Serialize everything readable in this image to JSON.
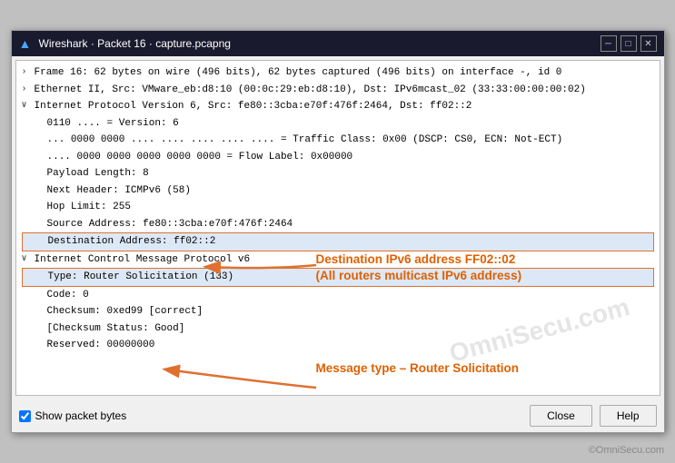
{
  "window": {
    "title": "Wireshark · Packet 16 · capture.pcapng",
    "titlebar_icon": "▲"
  },
  "titlebar_buttons": {
    "minimize": "─",
    "maximize": "□",
    "close": "✕"
  },
  "packet_rows": [
    {
      "id": "frame",
      "toggle": "›",
      "indent": 0,
      "text": "Frame 16: 62 bytes on wire (496 bits), 62 bytes captured (496 bits) on interface -, id 0",
      "highlight": false
    },
    {
      "id": "ethernet",
      "toggle": "›",
      "indent": 0,
      "text": "Ethernet II, Src: VMware_eb:d8:10 (00:0c:29:eb:d8:10), Dst: IPv6mcast_02 (33:33:00:00:00:02)",
      "highlight": false
    },
    {
      "id": "ipv6",
      "toggle": "∨",
      "indent": 0,
      "text": "Internet Protocol Version 6, Src: fe80::3cba:e70f:476f:2464, Dst: ff02::2",
      "highlight": false
    },
    {
      "id": "version",
      "toggle": " ",
      "indent": 1,
      "text": "0110 .... = Version: 6",
      "highlight": false
    },
    {
      "id": "traffic_class1",
      "toggle": " ",
      "indent": 1,
      "text": "... 0000 0000 .... .... .... .... .... = Traffic Class: 0x00 (DSCP: CS0, ECN: Not-ECT)",
      "highlight": false
    },
    {
      "id": "flow_label",
      "toggle": " ",
      "indent": 1,
      "text": ".... 0000 0000 0000 0000 0000 = Flow Label: 0x00000",
      "highlight": false
    },
    {
      "id": "payload_len",
      "toggle": " ",
      "indent": 1,
      "text": "Payload Length: 8",
      "highlight": false
    },
    {
      "id": "next_header",
      "toggle": " ",
      "indent": 1,
      "text": "Next Header: ICMPv6 (58)",
      "highlight": false
    },
    {
      "id": "hop_limit",
      "toggle": " ",
      "indent": 1,
      "text": "Hop Limit: 255",
      "highlight": false
    },
    {
      "id": "src_addr",
      "toggle": " ",
      "indent": 1,
      "text": "Source Address: fe80::3cba:e70f:476f:2464",
      "highlight": false
    },
    {
      "id": "dst_addr",
      "toggle": " ",
      "indent": 1,
      "text": "Destination Address: ff02::2",
      "highlight": true
    },
    {
      "id": "icmpv6",
      "toggle": "∨",
      "indent": 0,
      "text": "Internet Control Message Protocol v6",
      "highlight": false
    },
    {
      "id": "type",
      "toggle": " ",
      "indent": 1,
      "text": "Type: Router Solicitation (133)",
      "highlight": true
    },
    {
      "id": "code",
      "toggle": " ",
      "indent": 1,
      "text": "Code: 0",
      "highlight": false
    },
    {
      "id": "checksum",
      "toggle": " ",
      "indent": 1,
      "text": "Checksum: 0xed99 [correct]",
      "highlight": false
    },
    {
      "id": "checksum_status",
      "toggle": " ",
      "indent": 1,
      "text": "[Checksum Status: Good]",
      "highlight": false
    },
    {
      "id": "reserved",
      "toggle": " ",
      "indent": 1,
      "text": "Reserved: 00000000",
      "highlight": false
    }
  ],
  "annotations": {
    "dest_title": "Destination IPv6 address FF02::02",
    "dest_subtitle": "(All routers multicast IPv6 address)",
    "type_label": "Message type – Router Solicitation"
  },
  "footer": {
    "checkbox_label": "Show packet bytes",
    "close_btn": "Close",
    "help_btn": "Help"
  },
  "watermark": {
    "main": "OmniSecu.com",
    "copy": "©OmniSecu.com"
  }
}
